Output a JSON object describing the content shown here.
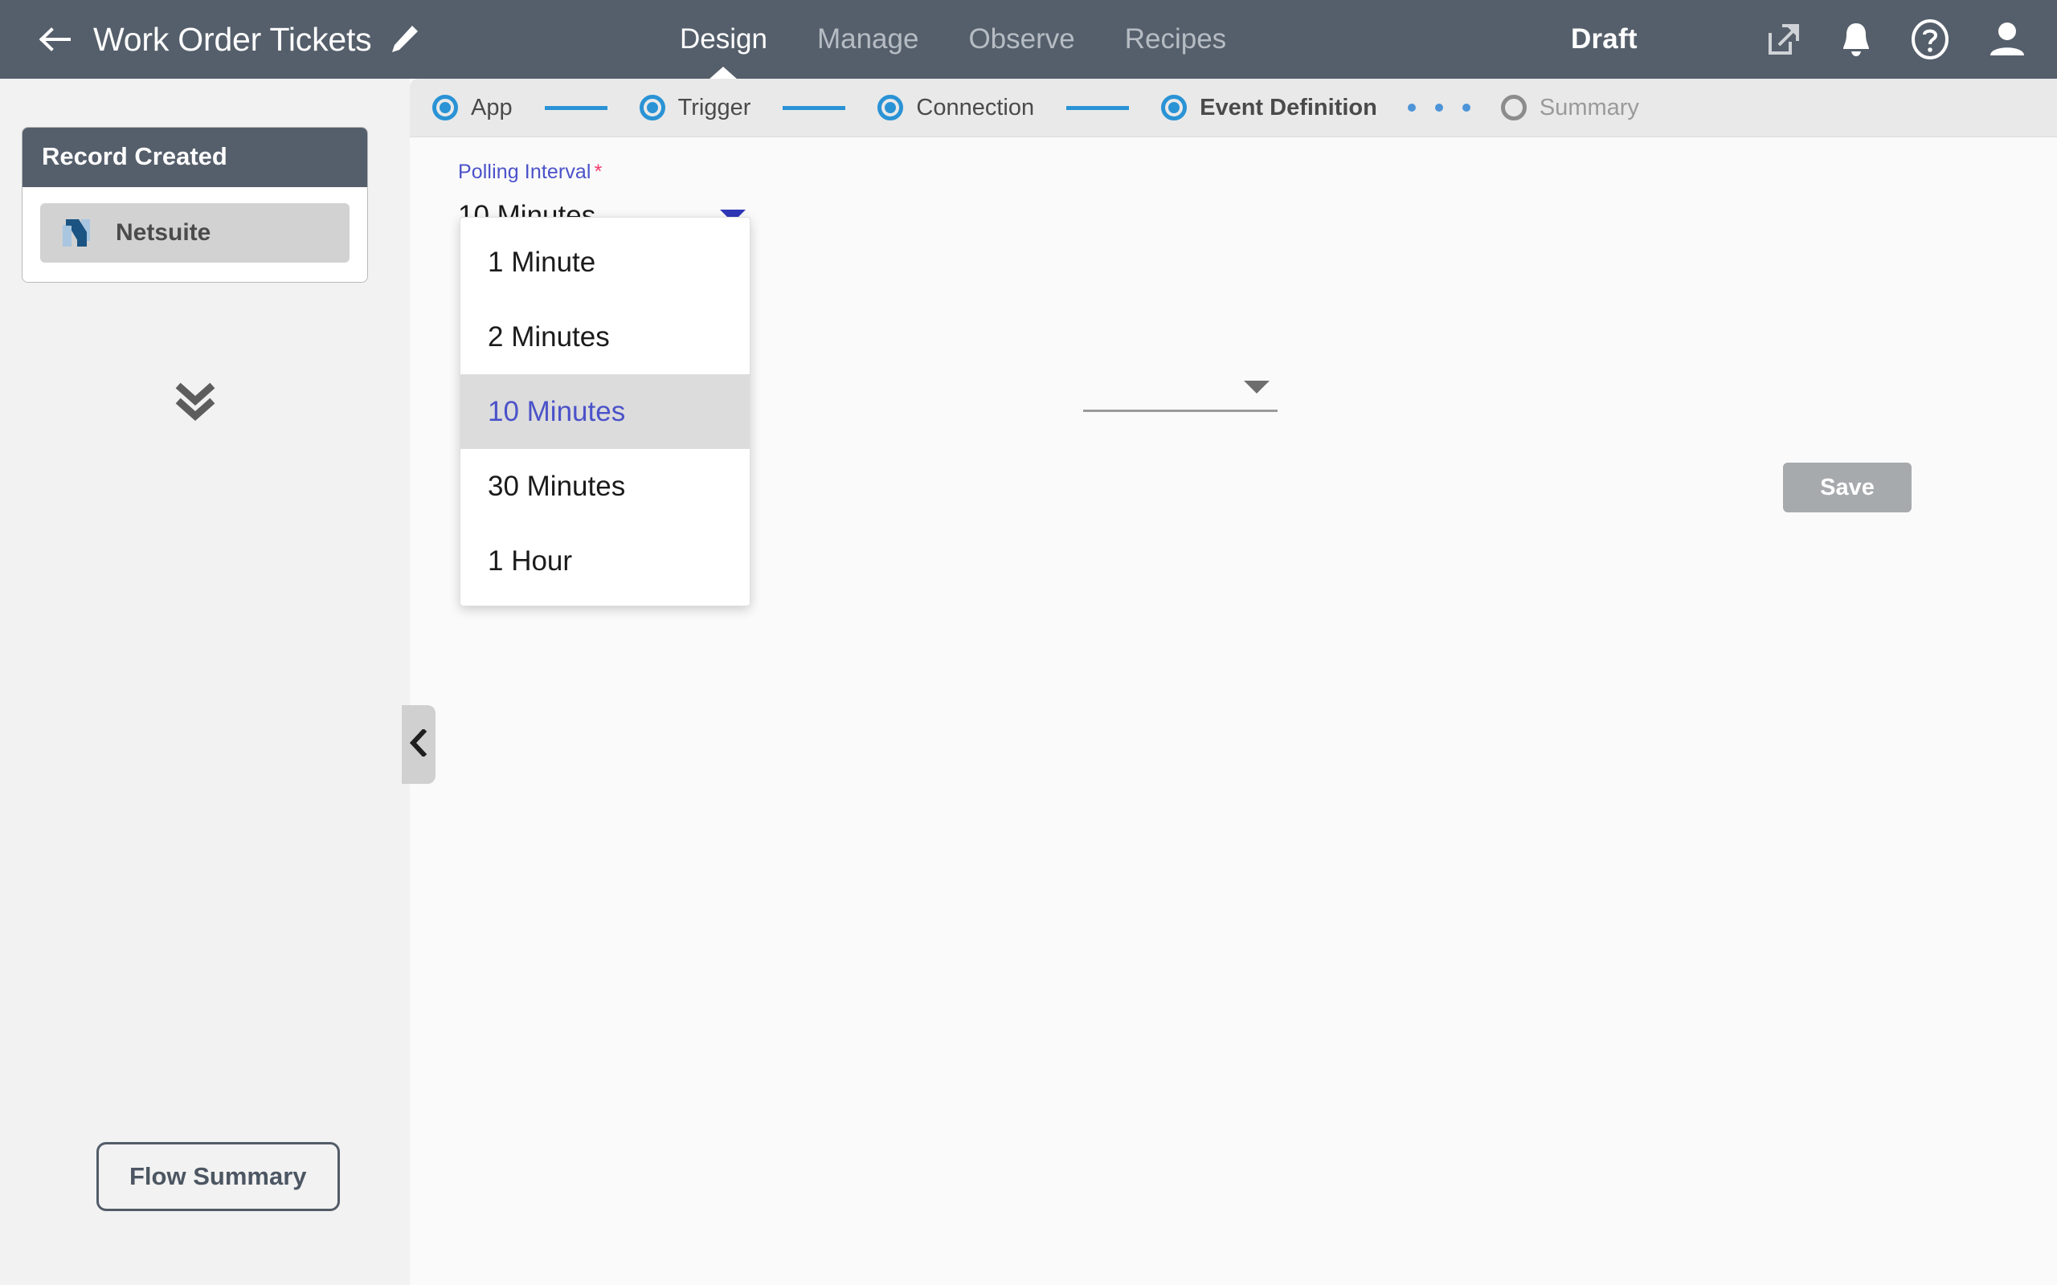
{
  "header": {
    "back_icon": "arrow-left-icon",
    "title": "Work Order Tickets",
    "edit_icon": "pencil-icon",
    "status": "Draft",
    "tabs": [
      {
        "label": "Design",
        "active": true
      },
      {
        "label": "Manage",
        "active": false
      },
      {
        "label": "Observe",
        "active": false
      },
      {
        "label": "Recipes",
        "active": false
      }
    ],
    "icons": [
      {
        "name": "external-link-icon"
      },
      {
        "name": "bell-icon"
      },
      {
        "name": "help-circle-icon"
      },
      {
        "name": "user-avatar-icon"
      }
    ]
  },
  "stepper": {
    "steps": [
      {
        "label": "App",
        "state": "complete",
        "bold": false
      },
      {
        "label": "Trigger",
        "state": "complete",
        "bold": false
      },
      {
        "label": "Connection",
        "state": "complete",
        "bold": false
      },
      {
        "label": "Event Definition",
        "state": "current",
        "bold": true
      },
      {
        "label": "Summary",
        "state": "pending",
        "bold": false
      }
    ],
    "dot_count": 3
  },
  "left_panel": {
    "flow_card": {
      "title": "Record Created",
      "app_name": "Netsuite",
      "app_icon": "netsuite-logo-icon"
    },
    "expand_icon": "double-chevron-down-icon",
    "flow_summary_label": "Flow Summary",
    "collapse_icon": "chevron-left-icon"
  },
  "form": {
    "polling_interval": {
      "label": "Polling Interval",
      "required_marker": "*",
      "value": "10 Minutes",
      "caret_icon": "caret-down-icon",
      "options": [
        "1 Minute",
        "2 Minutes",
        "10 Minutes",
        "30 Minutes",
        "1 Hour"
      ],
      "selected_index": 2
    },
    "secondary_field": {
      "value": "",
      "caret_icon": "caret-down-icon"
    },
    "save_label": "Save"
  },
  "colors": {
    "header_bg": "#555f6b",
    "accent_blue": "#2a93d5",
    "label_indigo": "#4b52c9",
    "required_pink": "#f13a6a",
    "left_panel_bg": "#f2f2f2",
    "right_panel_bg": "#fafafa",
    "stepper_bg": "#e9e9e9",
    "save_disabled": "#a7aaad"
  }
}
